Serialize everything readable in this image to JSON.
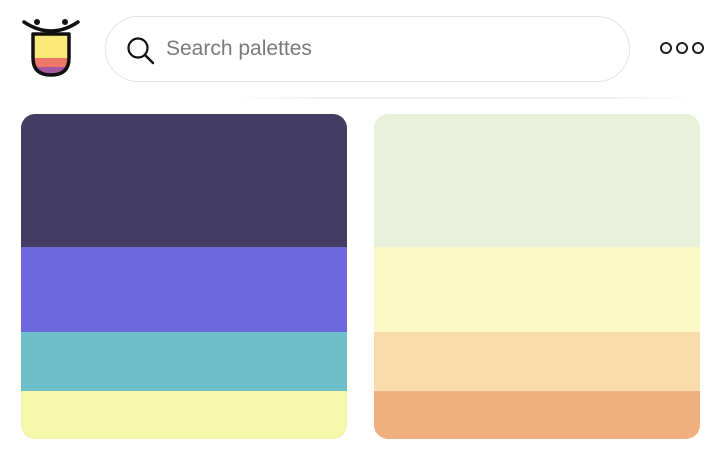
{
  "search": {
    "placeholder": "Search palettes",
    "value": ""
  },
  "icons": {
    "logo": "tongue-face-logo-icon",
    "search": "search-icon",
    "more": "more-options-icon"
  },
  "palettes": [
    {
      "colors": [
        "#433c63",
        "#6d68dc",
        "#6dbfc8",
        "#f5f7ab"
      ]
    },
    {
      "colors": [
        "#eaf1da",
        "#fbf9c5",
        "#f8dcab",
        "#efaf7e"
      ]
    }
  ]
}
